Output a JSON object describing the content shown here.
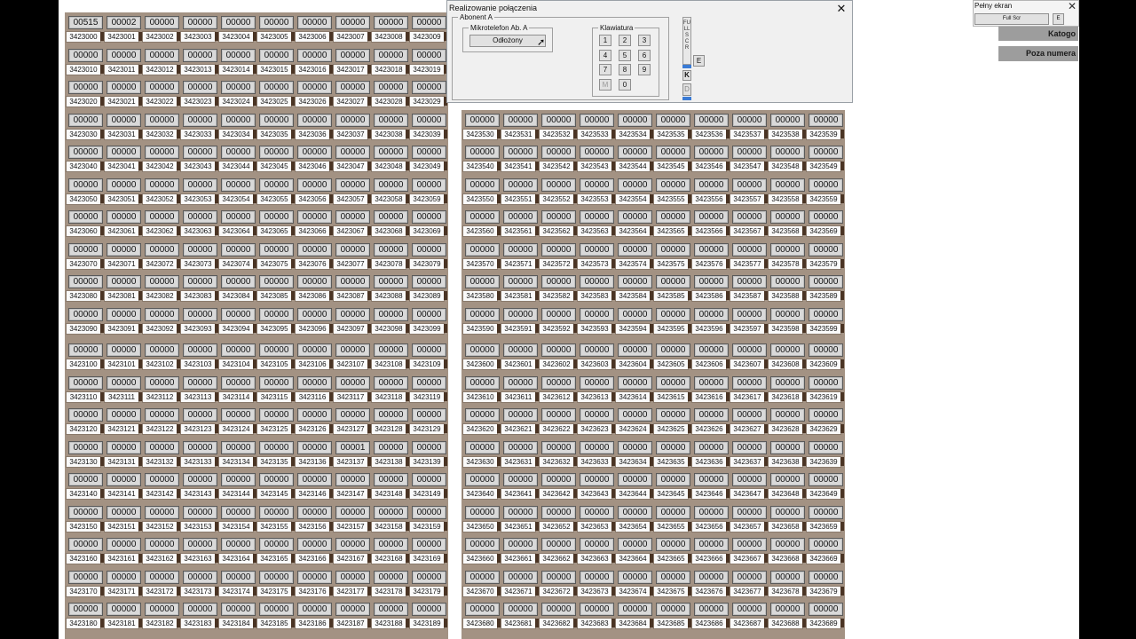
{
  "switchboard": {
    "left_grid_numbers_start": 3423000,
    "left_grid_numbers_end": 3423189,
    "right_grid_numbers_start": 3423530,
    "right_grid_numbers_end": 3423689,
    "default_counter": "00000",
    "counter_overrides": {
      "3423000": "00515",
      "3423001": "00002",
      "3423137": "00001"
    }
  },
  "dialog": {
    "title": "Realizowanie połączenia",
    "close_icon": "close-icon",
    "abonent_group": "Abonent A",
    "handset_group": "Mikrotelefon Ab. A",
    "handset_button": "Odłożony",
    "keypad_group": "Klawiatura",
    "keys": [
      "1",
      "2",
      "3",
      "4",
      "5",
      "6",
      "7",
      "8",
      "9",
      "M",
      "0"
    ],
    "fullscr_vertical": "FULLSCR",
    "e_button": "E",
    "k_button": "K",
    "d_button": "D"
  },
  "fullscreen_panel": {
    "title": "Pełny ekran",
    "full_scr_button": "Full Scr",
    "e_button": "E"
  },
  "side_labels": {
    "kategory": "Katogo",
    "poza_numera": "Poza numera"
  },
  "colors": {
    "cell_bg": "#a39283",
    "counter_bg": "#d9d9d9",
    "page_bg": "#ffffff"
  }
}
